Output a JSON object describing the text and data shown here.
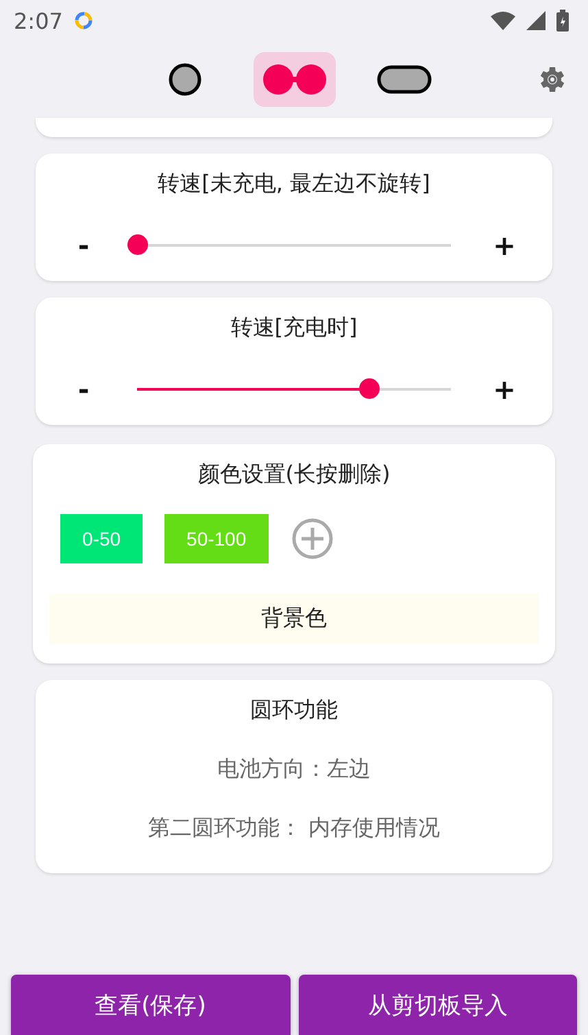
{
  "status_bar": {
    "time": "2:07"
  },
  "tabs": [
    {
      "kind": "circle",
      "selected": false
    },
    {
      "kind": "dual",
      "selected": true
    },
    {
      "kind": "capsule",
      "selected": false
    }
  ],
  "sliders": [
    {
      "title": "转速[未充电, 最左边不旋转]",
      "minus": "-",
      "plus": "+",
      "level": 0
    },
    {
      "title": "转速[充电时]",
      "minus": "-",
      "plus": "+",
      "level": 0.74
    }
  ],
  "color_settings": {
    "title": "颜色设置(长按删除)",
    "items": [
      {
        "label": "0-50",
        "color": "#00e676"
      },
      {
        "label": "50-100",
        "color": "#64dd17"
      }
    ],
    "background_label": "背景色"
  },
  "ring": {
    "title": "圆环功能",
    "rows": [
      "电池方向：左边",
      "第二圆环功能： 内存使用情况"
    ]
  },
  "buttons": [
    "查看(保存)",
    "从剪切板导入"
  ]
}
